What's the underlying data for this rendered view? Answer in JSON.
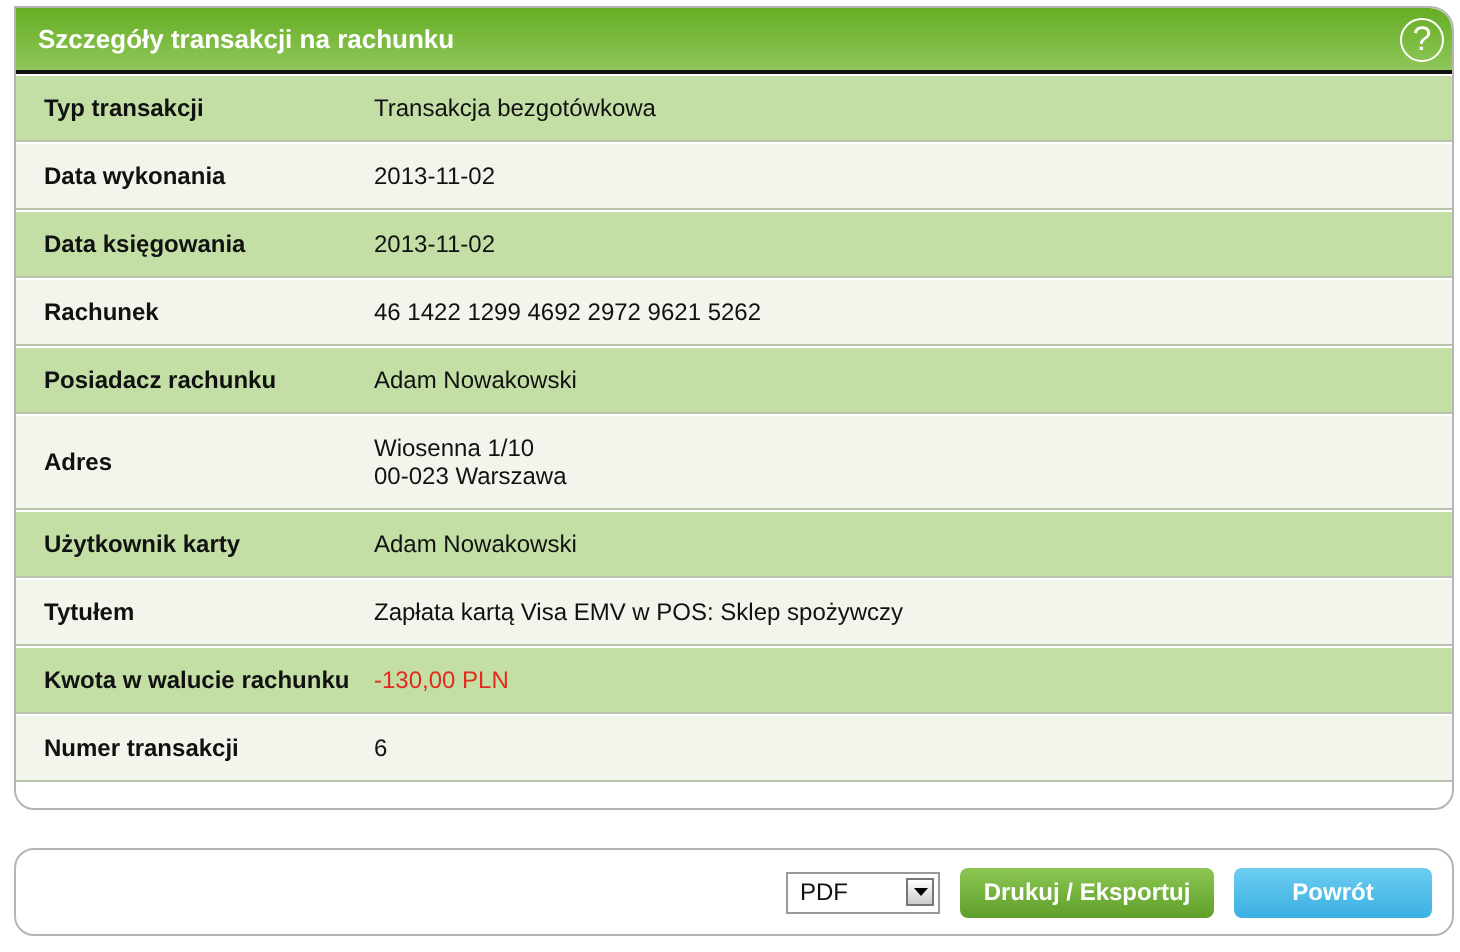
{
  "panel": {
    "title": "Szczegóły transakcji na rachunku",
    "help": "?"
  },
  "rows": [
    {
      "label": "Typ transakcji",
      "value": "Transakcja bezgotówkowa",
      "kind": "text"
    },
    {
      "label": "Data wykonania",
      "value": "2013-11-02",
      "kind": "text"
    },
    {
      "label": "Data księgowania",
      "value": "2013-11-02",
      "kind": "text"
    },
    {
      "label": "Rachunek",
      "value": "46 1422 1299 4692 2972 9621 5262",
      "kind": "text"
    },
    {
      "label": "Posiadacz rachunku",
      "value": "Adam Nowakowski",
      "kind": "text"
    },
    {
      "label": "Adres",
      "value": "Wiosenna 1/10\n00-023 Warszawa",
      "kind": "text"
    },
    {
      "label": "Użytkownik karty",
      "value": "Adam Nowakowski",
      "kind": "text"
    },
    {
      "label": "Tytułem",
      "value": "Zapłata kartą Visa EMV w POS: Sklep spożywczy",
      "kind": "text"
    },
    {
      "label": "Kwota w walucie rachunku",
      "value": "-130,00 PLN",
      "kind": "amount"
    },
    {
      "label": "Numer transakcji",
      "value": "6",
      "kind": "text"
    }
  ],
  "actions": {
    "format": "PDF",
    "export_button": "Drukuj / Eksportuj",
    "back_button": "Powrót"
  }
}
